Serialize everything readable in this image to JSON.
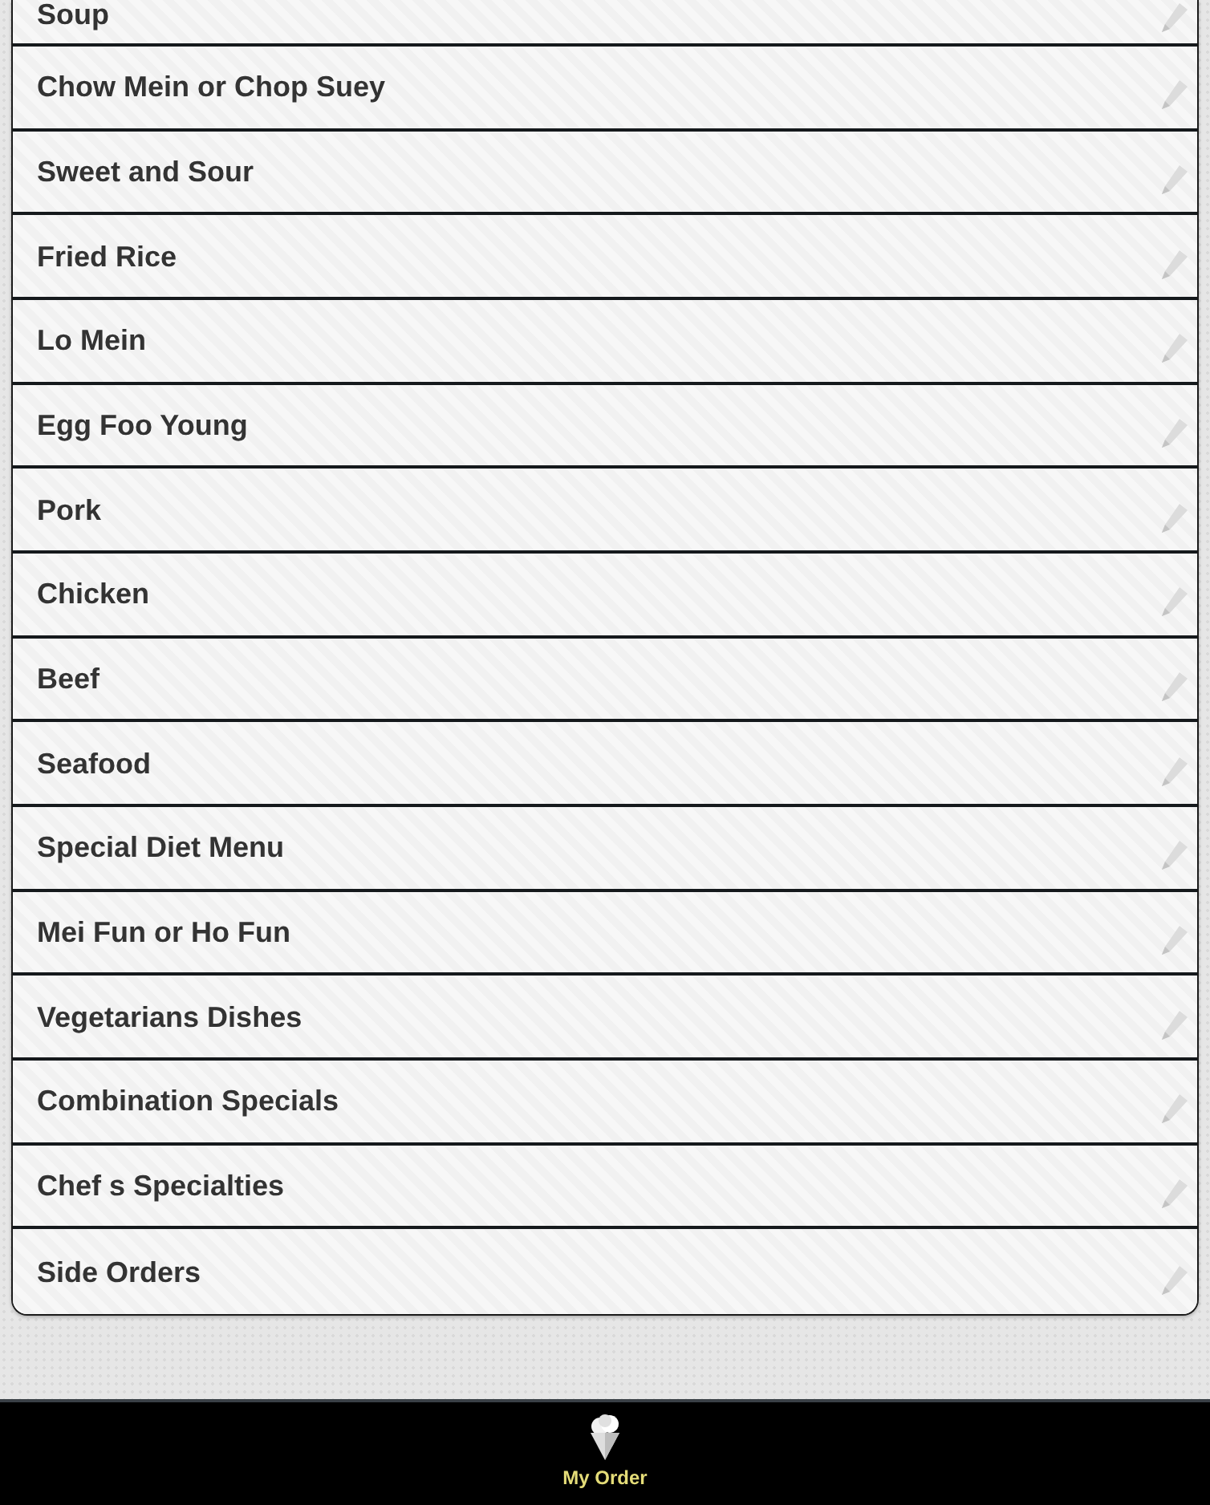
{
  "categories": [
    "Soup",
    "Chow Mein or Chop Suey",
    "Sweet and Sour",
    "Fried Rice",
    "Lo Mein",
    "Egg Foo Young",
    "Pork",
    "Chicken",
    "Beef",
    "Seafood",
    "Special Diet Menu",
    "Mei Fun or Ho Fun",
    "Vegetarians Dishes",
    "Combination Specials",
    "Chef s Specialties",
    "Side Orders"
  ],
  "footer": {
    "label": "My Order"
  }
}
